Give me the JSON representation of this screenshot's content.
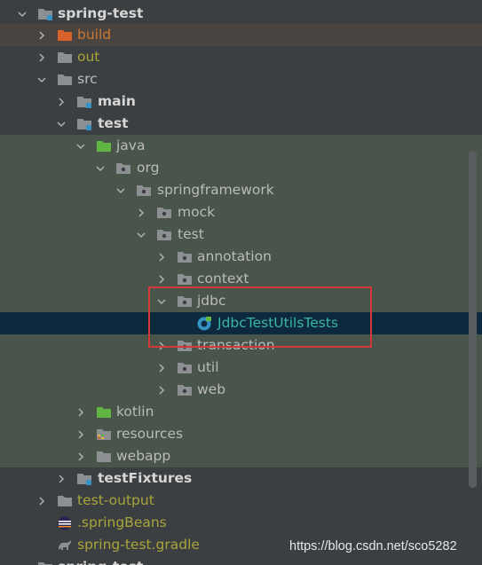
{
  "tree": {
    "nodes": [
      {
        "label": "spring-test",
        "arrow": "down",
        "icon": "module-folder-icon"
      },
      {
        "label": "build",
        "arrow": "right",
        "icon": "excluded-folder-icon"
      },
      {
        "label": "out",
        "arrow": "right",
        "icon": "folder-icon"
      },
      {
        "label": "src",
        "arrow": "down",
        "icon": "folder-icon"
      },
      {
        "label": "main",
        "arrow": "right",
        "icon": "module-folder-icon"
      },
      {
        "label": "test",
        "arrow": "down",
        "icon": "module-folder-icon"
      },
      {
        "label": "java",
        "arrow": "down",
        "icon": "test-source-folder-icon"
      },
      {
        "label": "org",
        "arrow": "down",
        "icon": "package-icon"
      },
      {
        "label": "springframework",
        "arrow": "down",
        "icon": "package-icon"
      },
      {
        "label": "mock",
        "arrow": "right",
        "icon": "package-icon"
      },
      {
        "label": "test",
        "arrow": "down",
        "icon": "package-icon"
      },
      {
        "label": "annotation",
        "arrow": "right",
        "icon": "package-icon"
      },
      {
        "label": "context",
        "arrow": "right",
        "icon": "package-icon"
      },
      {
        "label": "jdbc",
        "arrow": "down",
        "icon": "package-icon"
      },
      {
        "label": "JdbcTestUtilsTests",
        "arrow": "none",
        "icon": "test-class-icon"
      },
      {
        "label": "transaction",
        "arrow": "right",
        "icon": "package-icon"
      },
      {
        "label": "util",
        "arrow": "right",
        "icon": "package-icon"
      },
      {
        "label": "web",
        "arrow": "right",
        "icon": "package-icon"
      },
      {
        "label": "kotlin",
        "arrow": "right",
        "icon": "test-source-folder-icon"
      },
      {
        "label": "resources",
        "arrow": "right",
        "icon": "resources-folder-icon"
      },
      {
        "label": "webapp",
        "arrow": "right",
        "icon": "folder-icon"
      },
      {
        "label": "testFixtures",
        "arrow": "right",
        "icon": "module-folder-icon"
      },
      {
        "label": "test-output",
        "arrow": "right",
        "icon": "folder-icon"
      },
      {
        "label": ".springBeans",
        "arrow": "none",
        "icon": "eclipse-file-icon"
      },
      {
        "label": "spring-test.gradle",
        "arrow": "none",
        "icon": "gradle-icon"
      },
      {
        "label": "spring-test",
        "arrow": "down",
        "icon": "module-folder-icon"
      }
    ]
  },
  "watermark": "https://blog.csdn.net/sco5282",
  "colors": {
    "background": "#3c3f41",
    "test_area": "#49544a",
    "selected_row": "#0d293e",
    "excluded_text": "#cc7832",
    "olive_text": "#a9a53a",
    "test_class_text": "#3bb5a4",
    "highlight_border": "#d3383a"
  }
}
